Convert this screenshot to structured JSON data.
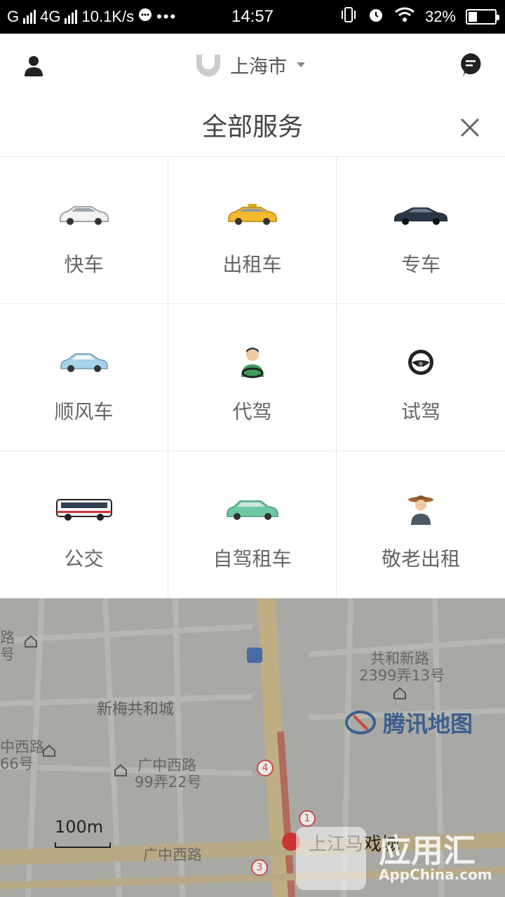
{
  "status_bar": {
    "carrier1": "G",
    "carrier2": "4G",
    "speed": "10.1K/s",
    "dots": "•••",
    "time": "14:57",
    "battery": "32%"
  },
  "header": {
    "city": "上海市"
  },
  "panel": {
    "title": "全部服务"
  },
  "services": [
    {
      "label": "快车",
      "icon": "white-car-icon"
    },
    {
      "label": "出租车",
      "icon": "taxi-icon"
    },
    {
      "label": "专车",
      "icon": "premier-car-icon"
    },
    {
      "label": "顺风车",
      "icon": "hitch-car-icon"
    },
    {
      "label": "代驾",
      "icon": "driver-icon"
    },
    {
      "label": "试驾",
      "icon": "steering-wheel-icon"
    },
    {
      "label": "公交",
      "icon": "bus-icon"
    },
    {
      "label": "自驾租车",
      "icon": "rental-car-icon"
    },
    {
      "label": "敬老出租",
      "icon": "elderly-icon"
    }
  ],
  "map": {
    "labels": {
      "road1a": "路",
      "road1b": "号",
      "gonghe1": "共和新路",
      "gonghe2": "2399弄13号",
      "xinmei": "新梅共和城",
      "xizhong1": "中西路",
      "xizhong2": "66号",
      "guangzhong1": "广中西路",
      "guangzhong2": "99弄22号",
      "guangzhong3": "广中西路",
      "metro": "上江马戏城"
    },
    "scale": "100m",
    "brand": "腾讯地图",
    "badges": [
      "4",
      "1",
      "3"
    ]
  },
  "watermark": {
    "main": "应用汇",
    "sub": "AppChina.com"
  }
}
